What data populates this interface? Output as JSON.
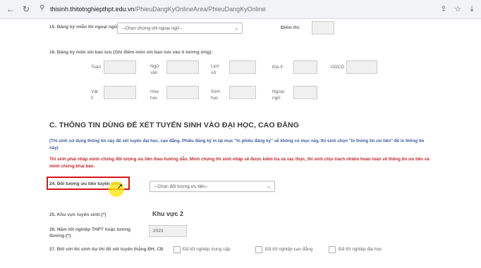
{
  "browser": {
    "url_host": "thisinh.thitotnghiepthpt.edu.vn",
    "url_path": "/PhieuDangKyOnlineArea/PhieuDangKyOnline"
  },
  "form": {
    "q15": {
      "label": "15. Đăng ký miễn thi ngoại ngữ:",
      "select_placeholder": "--Chọn chứng chỉ ngoại ngữ--",
      "score_label": "Điểm thi:"
    },
    "q16": {
      "label": "16. Đăng ký môn xin bảo lưu (Ghi điểm môn xin bảo lưu vào ô tương ứng):",
      "subjects_row1": [
        "Toán",
        "Ngữ văn",
        "Lịch sử",
        "Địa lí",
        "GDCD"
      ],
      "subjects_row2": [
        "Vật lí",
        "Hóa học",
        "Sinh học",
        "Ngoại ngữ"
      ]
    },
    "section_c": {
      "title": "C. THÔNG TIN DÙNG ĐỂ XÉT TUYỂN SINH VÀO ĐẠI HỌC, CAO ĐẲNG",
      "note_blue": "(Thí sinh sử dụng thông tin này để xét tuyển đại học, cao đẳng. Phiếu đăng ký in tại mục \"In phiếu đăng ký\" sẽ không có mục này, thí sinh chọn \"In thông tin ưu tiên\" để in thông tin này)",
      "note_red": "Thí sinh phải nhập minh chứng đối tượng ưu tiên theo hướng dẫn. Minh chứng thí sinh nhập sẽ được kiểm tra và xác thực, thí sinh chịu trách nhiệm hoàn toàn về thông tin ưu tiên và minh chứng khai báo."
    },
    "q24": {
      "label": "24. Đối tượng ưu tiên tuyển sinh:",
      "select_placeholder": "--Chọn đối tượng ưu tiên--"
    },
    "q25": {
      "label": "25. Khu vực tuyển sinh:(*)",
      "value": "Khu vực 2"
    },
    "q26": {
      "label": "26. Năm tốt nghiệp THPT hoặc tương đương:(*)",
      "value": "2023"
    },
    "q27": {
      "label": "27. Đối với thí sinh dự thi để xét tuyển thẳng ĐH, CĐ",
      "options": [
        "Đã tốt nghiệp trung cấp",
        "Đã tốt nghiệp cao đẳng",
        "Đã tốt nghiệp đại học"
      ]
    }
  }
}
